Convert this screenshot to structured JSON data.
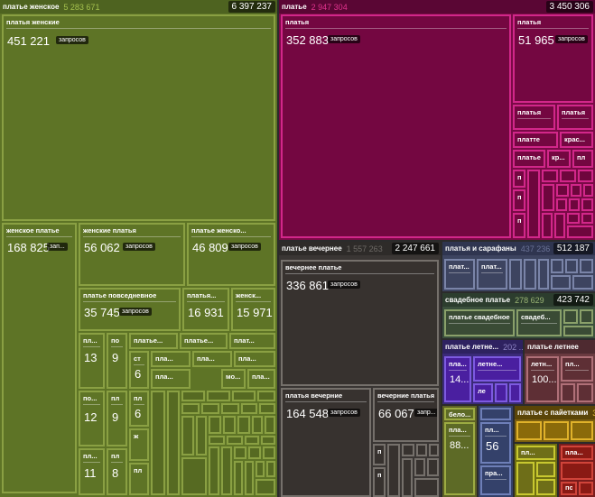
{
  "groups": {
    "zhenskoe": {
      "name": "платье женское",
      "sub": "5 283 671",
      "total": "6 397 237"
    },
    "platie": {
      "name": "платье",
      "sub": "2 947 304",
      "total": "3 450 306"
    },
    "vechernee": {
      "name": "платье вечернее",
      "sub": "1 557 263",
      "total": "2 247 661"
    },
    "sarafany": {
      "name": "платья и сарафаны",
      "sub": "437 236",
      "total": "512 187"
    },
    "svadebnoe": {
      "name": "свадебное платье",
      "sub": "278 629",
      "total": "423 742"
    },
    "letnee1": {
      "name": "платье летне...",
      "sub": "202 ..."
    },
    "letnee2": {
      "name": "платье летнее"
    },
    "paietki": {
      "name": "платье с пайетками",
      "sub": "3"
    }
  },
  "tiles": {
    "zh_main": {
      "name": "платья женские",
      "value": "451 221",
      "badge": "запросов"
    },
    "zh_2": {
      "name": "женское платье",
      "value": "168 825",
      "badge": "зап..."
    },
    "zh_3": {
      "name": "женские платья",
      "value": "56 062",
      "badge": "запросов"
    },
    "zh_4": {
      "name": "платье женско...",
      "value": "46 809",
      "badge": "запросов"
    },
    "zh_5": {
      "name": "платье повседневное",
      "value": "35 745",
      "badge": "запросов"
    },
    "zh_6": {
      "name": "платья...",
      "value": "16 931"
    },
    "zh_7": {
      "name": "женск...",
      "value": "15 971"
    },
    "zh_8": {
      "name": "пл...",
      "value": "13"
    },
    "zh_9": {
      "name": "по",
      "value": "9"
    },
    "zh_10": {
      "name": "платье...",
      "value": ""
    },
    "zh_11": {
      "name": "платье...",
      "value": ""
    },
    "zh_12": {
      "name": "плат...",
      "value": ""
    },
    "zh_13": {
      "name": "ст",
      "value": "6"
    },
    "zh_14": {
      "name": "пла...",
      "value": ""
    },
    "zh_15": {
      "name": "пла...",
      "value": ""
    },
    "zh_16": {
      "name": "мо...",
      "value": ""
    },
    "zh_17": {
      "name": "пла...",
      "value": ""
    },
    "zh_18": {
      "name": "по...",
      "value": "12"
    },
    "zh_19": {
      "name": "пл",
      "value": "9"
    },
    "zh_20": {
      "name": "пл",
      "value": "6"
    },
    "zh_21": {
      "name": "ж",
      "value": ""
    },
    "zh_22": {
      "name": "пл...",
      "value": "11"
    },
    "zh_23": {
      "name": "пл",
      "value": "8"
    },
    "zh_24": {
      "name": "пл",
      "value": ""
    },
    "zh_25": {
      "name": "плат...",
      "value": ""
    },
    "zh_26": {
      "name": "плат...",
      "value": ""
    },
    "pl_main": {
      "name": "платья",
      "value": "352 883",
      "badge": "запросов"
    },
    "pl_2": {
      "name": "платья",
      "value": "51 965",
      "badge": "запросов"
    },
    "pl_3": {
      "name": "платья",
      "value": ""
    },
    "pl_4": {
      "name": "платья",
      "value": ""
    },
    "pl_5": {
      "name": "платте",
      "value": ""
    },
    "pl_6": {
      "name": "крас...",
      "value": ""
    },
    "pl_7": {
      "name": "платье",
      "value": ""
    },
    "pl_8": {
      "name": "кр...",
      "value": ""
    },
    "pl_9": {
      "name": "пл",
      "value": ""
    },
    "pl_10": {
      "name": "п",
      "value": ""
    },
    "pl_11": {
      "name": "п",
      "value": ""
    },
    "pl_12": {
      "name": "п",
      "value": ""
    },
    "ve_main": {
      "name": "вечернее платье",
      "value": "336 861",
      "badge": "запросов"
    },
    "ve_2": {
      "name": "платья вечерние",
      "value": "164 548",
      "badge": "запросов"
    },
    "ve_3": {
      "name": "вечерние платья",
      "value": "66 067",
      "badge": "запр..."
    },
    "ve_4": {
      "name": "п",
      "value": ""
    },
    "ve_5": {
      "name": "п",
      "value": ""
    },
    "sa_1": {
      "name": "плат...",
      "value": ""
    },
    "sa_2": {
      "name": "плат...",
      "value": ""
    },
    "sv_1": {
      "name": "платье свадебное",
      "value": ""
    },
    "sv_2": {
      "name": "свадеб...",
      "value": ""
    },
    "le_1": {
      "name": "пла...",
      "value": "14..."
    },
    "le_2": {
      "name": "летне...",
      "value": ""
    },
    "le_3": {
      "name": "ле",
      "value": ""
    },
    "lt_1": {
      "name": "летн...",
      "value": "100..."
    },
    "lt_2": {
      "name": "пл...",
      "value": ""
    },
    "bo_1": {
      "name": "бело...",
      "value": ""
    },
    "bo_2": {
      "name": "пла...",
      "value": "88..."
    },
    "pa_1": {
      "name": "пл...",
      "value": "56"
    },
    "pa_2": {
      "name": "пра...",
      "value": ""
    },
    "pa_3": {
      "name": "пл...",
      "value": ""
    },
    "py_1": {
      "name": "пл...",
      "value": ""
    },
    "py_2": {
      "name": "пла...",
      "value": ""
    },
    "py_3": {
      "name": "по",
      "value": ""
    }
  }
}
